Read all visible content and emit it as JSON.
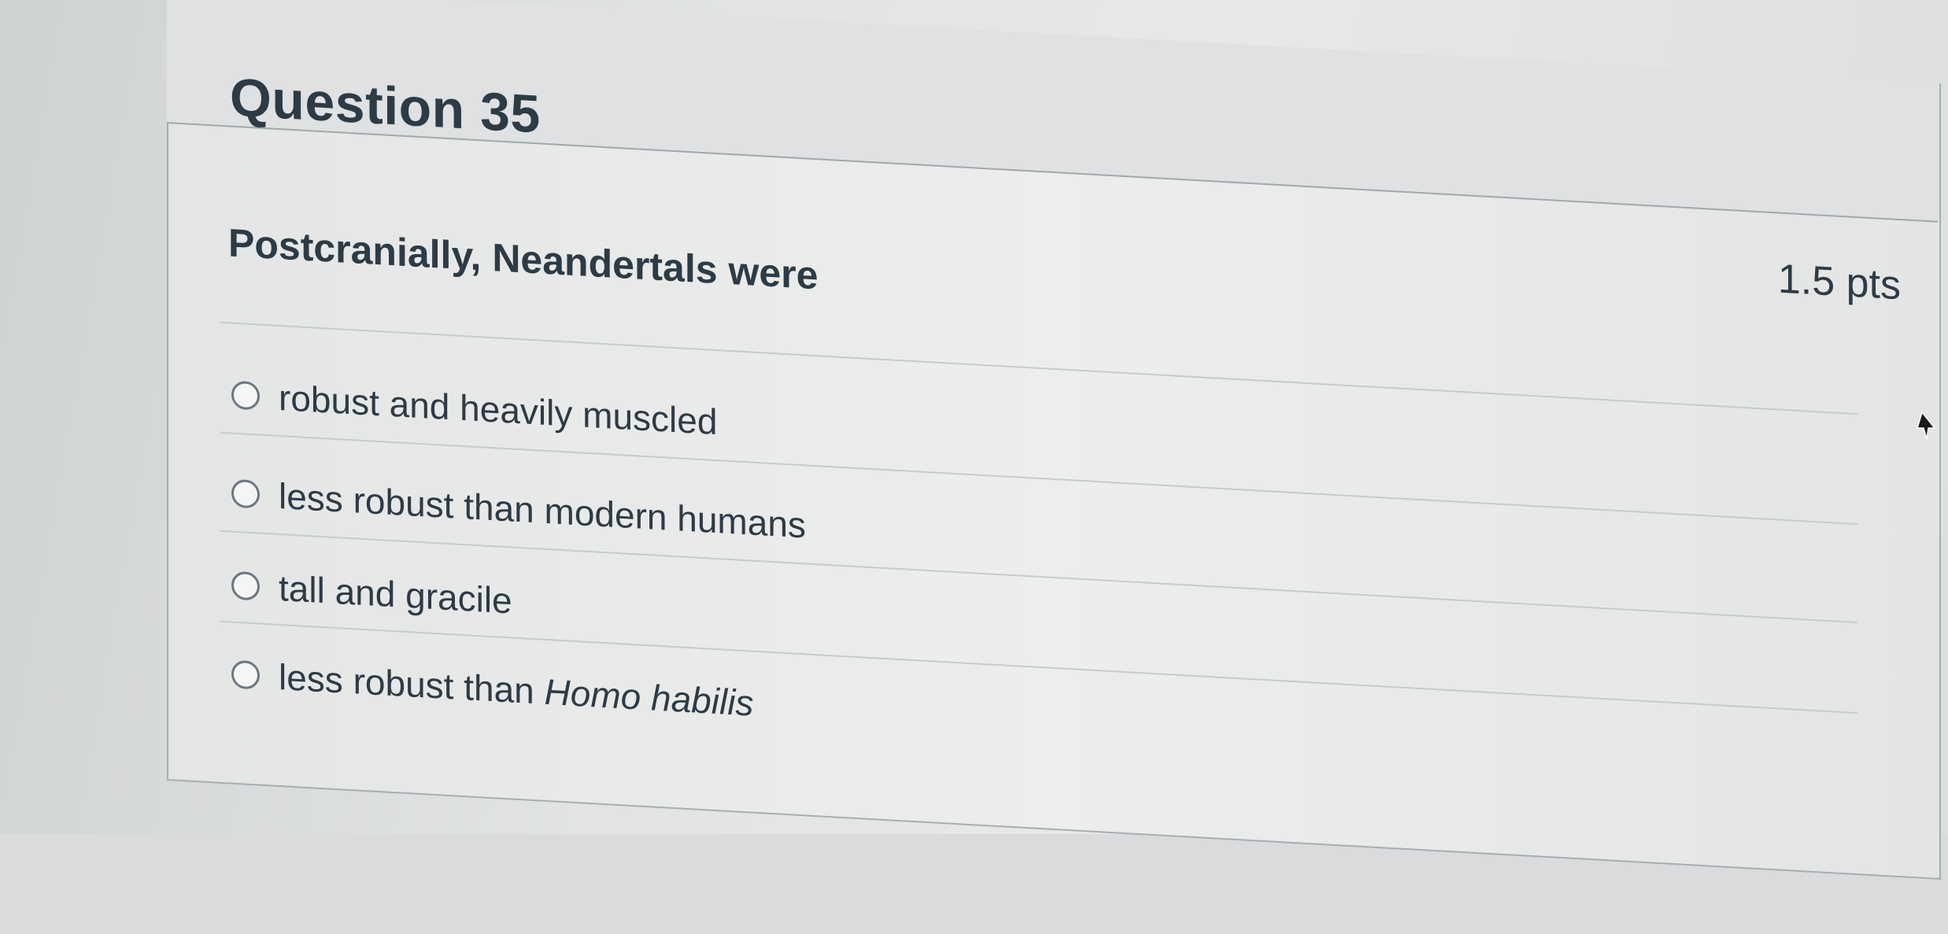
{
  "question": {
    "title": "Question 35",
    "points": "1.5 pts",
    "text": "Postcranially, Neandertals were"
  },
  "answers": [
    {
      "label": "robust and heavily muscled"
    },
    {
      "label": "less robust than modern humans"
    },
    {
      "label": "tall and gracile"
    },
    {
      "label_plain": "less robust than ",
      "label_italic": "Homo habilis"
    }
  ],
  "icons": {
    "cursor": "mouse-pointer-icon",
    "radio": "radio-button-icon"
  },
  "colors": {
    "text": "#2d3b45",
    "border": "#a9adb0"
  }
}
